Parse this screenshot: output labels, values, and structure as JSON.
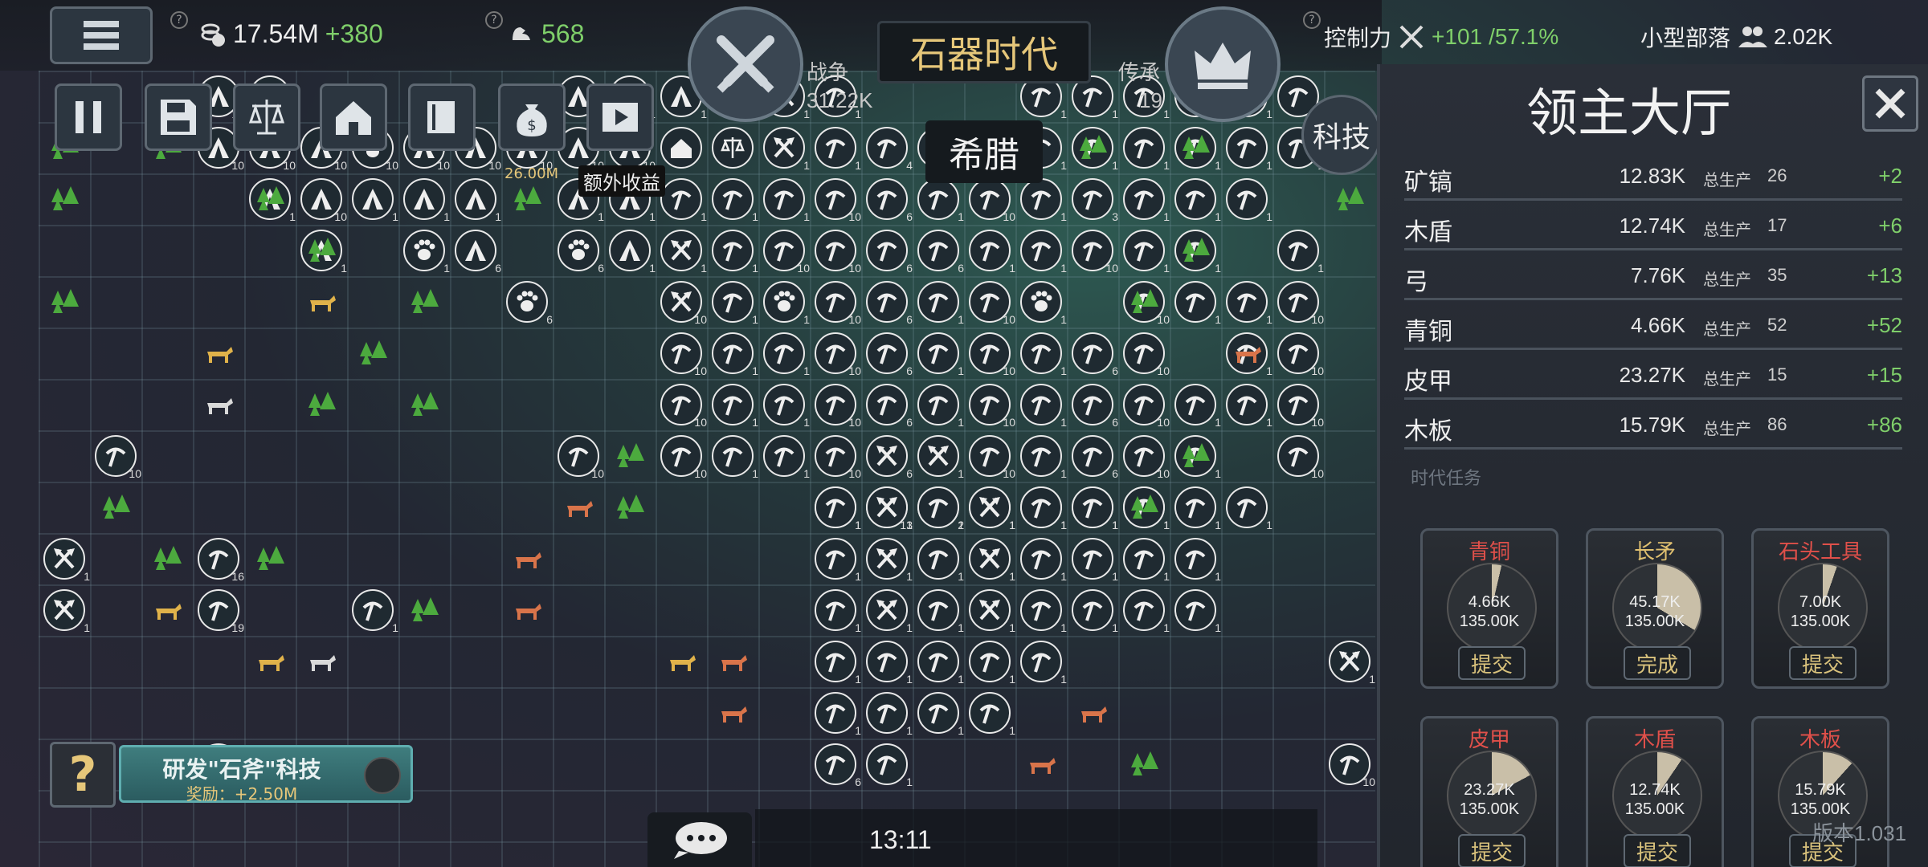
{
  "topbar": {
    "coins": "17.54M",
    "coins_delta": "+380",
    "strength": "568",
    "war_label": "战争",
    "war_value": "31.22K",
    "era": "石器时代",
    "inherit_label": "传承",
    "inherit_value": "19",
    "control_label": "控制力",
    "control_value": "+101",
    "control_pct": "/57.1%",
    "tribe_label": "小型部落",
    "population": "2.02K",
    "civilization": "希腊",
    "tech_label": "科技",
    "extra_income_value": "26.00M",
    "extra_income_label": "额外收益"
  },
  "panel": {
    "title": "领主大厅",
    "total_label": "总生产",
    "section_label": "时代任务",
    "resources": [
      {
        "name": "矿镐",
        "value": "12.83K",
        "total": "26",
        "delta": "+2"
      },
      {
        "name": "木盾",
        "value": "12.74K",
        "total": "17",
        "delta": "+6"
      },
      {
        "name": "弓",
        "value": "7.76K",
        "total": "35",
        "delta": "+13"
      },
      {
        "name": "青铜",
        "value": "4.66K",
        "total": "52",
        "delta": "+52"
      },
      {
        "name": "皮甲",
        "value": "23.27K",
        "total": "15",
        "delta": "+15"
      },
      {
        "name": "木板",
        "value": "15.79K",
        "total": "86",
        "delta": "+86"
      }
    ],
    "tasks": [
      {
        "name": "青铜",
        "current": "4.66K",
        "target": "135.00K",
        "button": "提交",
        "fraction": 0.035,
        "name_color": "#e0504a"
      },
      {
        "name": "长矛",
        "current": "45.17K",
        "target": "135.00K",
        "button": "完成",
        "fraction": 0.335,
        "name_color": "#e0c070"
      },
      {
        "name": "石头工具",
        "current": "7.00K",
        "target": "135.00K",
        "button": "提交",
        "fraction": 0.052,
        "name_color": "#e0504a"
      },
      {
        "name": "皮甲",
        "current": "23.27K",
        "target": "135.00K",
        "button": "提交",
        "fraction": 0.172,
        "name_color": "#e0504a"
      },
      {
        "name": "木盾",
        "current": "12.74K",
        "target": "135.00K",
        "button": "提交",
        "fraction": 0.094,
        "name_color": "#e0504a"
      },
      {
        "name": "木板",
        "current": "15.79K",
        "target": "135.00K",
        "button": "提交",
        "fraction": 0.117,
        "name_color": "#e0504a"
      }
    ]
  },
  "quest": {
    "title": "研发\"石斧\"科技",
    "reward": "奖励：+2.50M"
  },
  "help_icon": "?",
  "clock": "13:11",
  "version": "版本1.031",
  "colors": {
    "accent_gold": "#e6c77a",
    "positive": "#7fcf6a",
    "negative": "#e0504a",
    "quest_teal": "#3f7d7e"
  },
  "icons": [
    "menu-icon",
    "coin-icon",
    "strength-icon",
    "swords-icon",
    "crown-icon",
    "control-icon",
    "population-icon",
    "pause-icon",
    "save-icon",
    "scales-icon",
    "house-icon",
    "book-icon",
    "money-bag-icon",
    "video-icon",
    "close-icon",
    "chat-icon",
    "pickaxe-icon",
    "axe-icon",
    "tent-icon",
    "paw-icon",
    "tree-icon",
    "horse-icon",
    "sheep-icon",
    "cow-icon"
  ]
}
